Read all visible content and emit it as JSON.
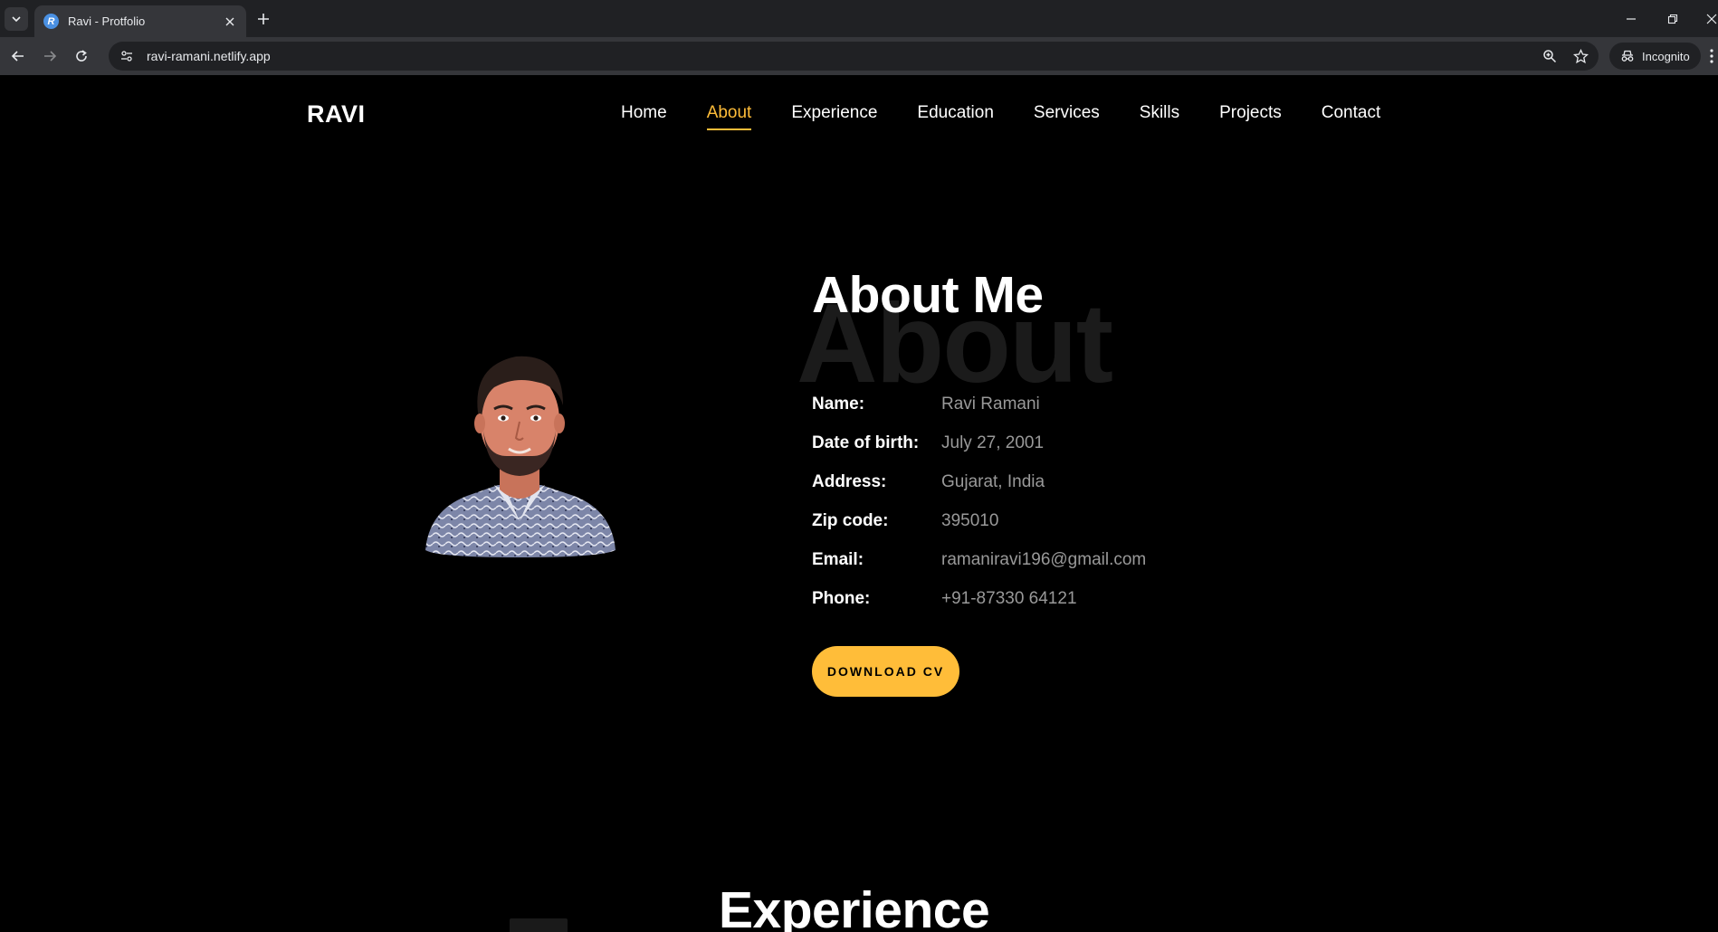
{
  "browser": {
    "tab_title": "Ravi - Protfolio",
    "favicon_letter": "R",
    "url": "ravi-ramani.netlify.app",
    "incognito_label": "Incognito"
  },
  "site": {
    "brand": "RAVI",
    "nav": [
      "Home",
      "About",
      "Experience",
      "Education",
      "Services",
      "Skills",
      "Projects",
      "Contact"
    ],
    "active_nav": "About"
  },
  "about": {
    "background_word": "About",
    "title": "About Me",
    "fields": [
      {
        "label": "Name:",
        "value": "Ravi Ramani"
      },
      {
        "label": "Date of birth:",
        "value": "July 27, 2001"
      },
      {
        "label": "Address:",
        "value": "Gujarat, India"
      },
      {
        "label": "Zip code:",
        "value": "395010"
      },
      {
        "label": "Email:",
        "value": "ramaniravi196@gmail.com"
      },
      {
        "label": "Phone:",
        "value": "+91-87330 64121"
      }
    ],
    "cv_button": "DOWNLOAD CV"
  },
  "experience": {
    "title": "Experience"
  },
  "colors": {
    "accent": "#ffbd39",
    "background": "#000000",
    "muted_text": "#999999"
  }
}
